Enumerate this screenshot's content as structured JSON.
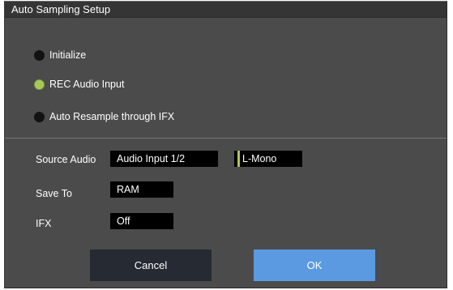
{
  "window": {
    "title": "Auto Sampling Setup"
  },
  "mode_options": [
    {
      "label": "Initialize",
      "selected": false
    },
    {
      "label": "REC Audio Input",
      "selected": true
    },
    {
      "label": "Auto Resample through IFX",
      "selected": false
    }
  ],
  "source_audio": {
    "label": "Source Audio",
    "value": "Audio Input 1/2",
    "channel": "L-Mono"
  },
  "save_to": {
    "label": "Save To",
    "value": "RAM"
  },
  "ifx": {
    "label": "IFX",
    "value": "Off"
  },
  "buttons": {
    "cancel_label": "Cancel",
    "ok_label": "OK"
  },
  "colors": {
    "dialog_bg": "#4b4b4b",
    "titlebar_bg": "#353535",
    "selected_radio": "#a8c858",
    "ok_button": "#5b9ae0",
    "cancel_button": "#262a32"
  }
}
